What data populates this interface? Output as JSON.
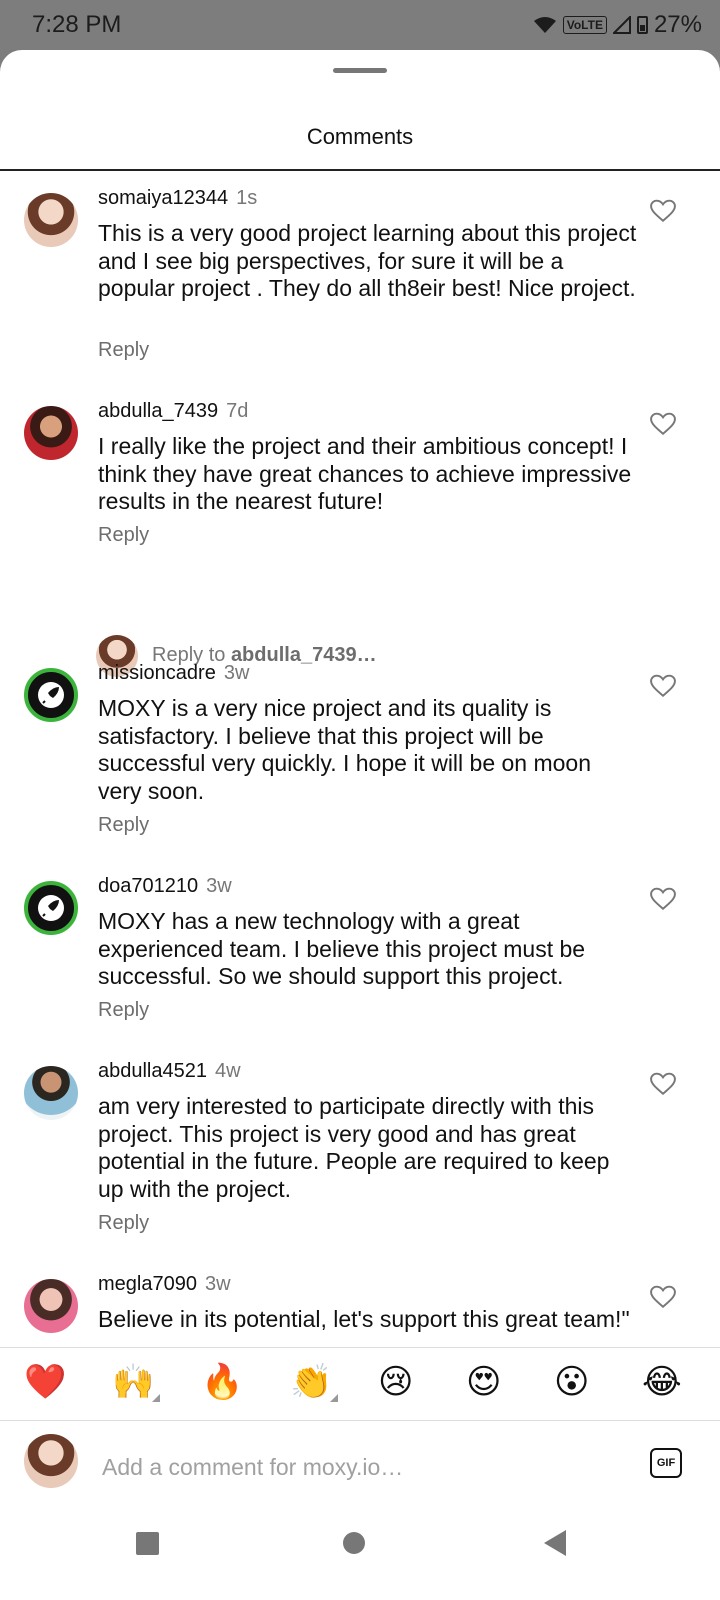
{
  "status_bar": {
    "time": "7:28 PM",
    "network_badge": "VoLTE",
    "battery": "27%"
  },
  "sheet": {
    "title": "Comments"
  },
  "comments": [
    {
      "username": "somaiya12344",
      "time": "1s",
      "text": "This is a very good project learning about this project and I see big perspectives, for sure it will be a popular project . They do all th8eir best! Nice project.",
      "reply_label": "Reply"
    },
    {
      "username": "abdulla_7439",
      "time": "7d",
      "text": "I really like the project and their ambitious concept! I think they have great chances to achieve impressive results in the nearest future!",
      "reply_label": "Reply"
    },
    {
      "username": "missioncadre",
      "time": "3w",
      "text": "MOXY is a very nice project and its quality is satisfactory. I believe that this project will be successful very quickly. I hope it will be on moon very soon.",
      "reply_label": "Reply"
    },
    {
      "username": "doa701210",
      "time": "3w",
      "text": "MOXY has a new technology with a great experienced team. I believe this project must be successful. So we should support this project.",
      "reply_label": "Reply"
    },
    {
      "username": "abdulla4521",
      "time": "4w",
      "text": "am very interested to participate directly with this project. This project is very good and has great potential in the future. People are required to keep up with the project.",
      "reply_label": "Reply"
    },
    {
      "username": "megla7090",
      "time": "3w",
      "text": "Believe in its potential, let's support this great team!\""
    }
  ],
  "reply_thread": {
    "prefix": "Reply to ",
    "target": "abdulla_7439…"
  },
  "reactions": [
    "❤️",
    "🙌",
    "🔥",
    "👏",
    "😢",
    "😍",
    "😮",
    "😂"
  ],
  "composer": {
    "placeholder": "Add a comment for moxy.io…",
    "gif_label": "GIF"
  },
  "icons": {
    "heart": "heart-outline-icon",
    "rocket": "rocket-icon"
  },
  "colors": {
    "rocket_ring": "#3cb43c",
    "secondary_text": "#6d6d6d"
  }
}
